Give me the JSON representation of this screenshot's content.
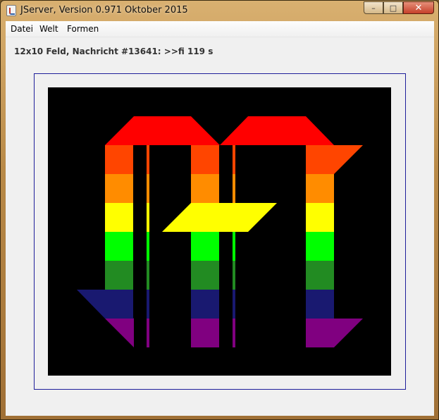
{
  "window": {
    "title": "JServer, Version 0.971 Oktober 2015",
    "controls": {
      "minimize": "–",
      "maximize": "□",
      "close": "✕"
    }
  },
  "menu": {
    "items": [
      "Datei",
      "Welt",
      "Formen"
    ]
  },
  "status": {
    "text": "12x10 Feld, Nachricht #13641: >>fi 119 s"
  },
  "board": {
    "columns": 12,
    "rows": 10,
    "background": "#000000",
    "frame_color": "#1e1e9a",
    "stripe_colors": [
      "#ff0000",
      "#ff4500",
      "#ff8c00",
      "#ffff00",
      "#00ff00",
      "#228b22",
      "#191970",
      "#800080"
    ]
  }
}
